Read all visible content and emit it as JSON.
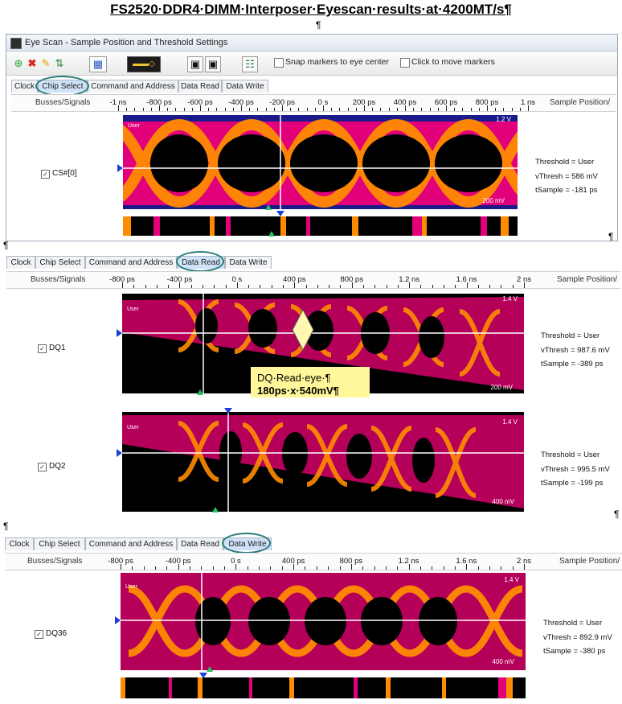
{
  "doc": {
    "title": "FS2520·DDR4·DIMM·Interposer·Eyescan·results·at·4200MT/s¶",
    "pilcrow": "¶"
  },
  "window": {
    "title": "Eye Scan - Sample Position and Threshold Settings",
    "toolbar": {
      "snap_label": "Snap markers to eye center",
      "click_label": "Click to move markers"
    }
  },
  "tabs": [
    "Clock",
    "Chip Select",
    "Command and Address",
    "Data Read",
    "Data Write"
  ],
  "header": {
    "signals_label": "Busses/Signals",
    "sample_position_label": "Sample Position/"
  },
  "panels": [
    {
      "active_tab": "Chip Select",
      "ticks": [
        "-1 ns",
        "-800 ps",
        "-600 ps",
        "-400 ps",
        "-200 ps",
        "0 s",
        "200 ps",
        "400 ps",
        "600 ps",
        "800 ps",
        "1 ns"
      ],
      "signals": [
        {
          "name": "CS#[0]",
          "checked": true,
          "top_voltage": "1.2 V",
          "bottom_voltage": "200 mV",
          "threshold": "Threshold = User",
          "vthresh": "vThresh = 586 mV",
          "tsample": "tSample = -181 ps"
        }
      ]
    },
    {
      "active_tab": "Data Read",
      "ticks": [
        "-800 ps",
        "-400 ps",
        "0 s",
        "400 ps",
        "800 ps",
        "1.2 ns",
        "1.6 ns",
        "2 ns"
      ],
      "signals": [
        {
          "name": "DQ1",
          "checked": true,
          "top_voltage": "1.4 V",
          "bottom_voltage": "200 mV",
          "threshold": "Threshold = User",
          "vthresh": "vThresh = 987.6 mV",
          "tsample": "tSample = -389 ps"
        },
        {
          "name": "DQ2",
          "checked": true,
          "top_voltage": "1.4 V",
          "bottom_voltage": "400 mV",
          "threshold": "Threshold = User",
          "vthresh": "vThresh = 995.5 mV",
          "tsample": "tSample = -199 ps"
        }
      ]
    },
    {
      "active_tab": "Data Write",
      "ticks": [
        "-800 ps",
        "-400 ps",
        "0 s",
        "400 ps",
        "800 ps",
        "1.2 ns",
        "1.6 ns",
        "2 ns"
      ],
      "signals": [
        {
          "name": "DQ36",
          "checked": true,
          "top_voltage": "1.4 V",
          "bottom_voltage": "400 mV",
          "threshold": "Threshold = User",
          "vthresh": "vThresh = 892.9 mV",
          "tsample": "tSample = -380 ps"
        }
      ]
    }
  ],
  "user_label": "User",
  "callout": {
    "line1": "DQ·Read·eye·¶",
    "line2": "180ps·x·540mV¶"
  },
  "colors": {
    "accent_circle": "#2a7c7c",
    "eye_orange": "#ff8c00",
    "eye_magenta": "#d2006e",
    "callout_bg": "#fff79a",
    "marker_blue": "#1d3fd8",
    "marker_green": "#23c46a"
  }
}
